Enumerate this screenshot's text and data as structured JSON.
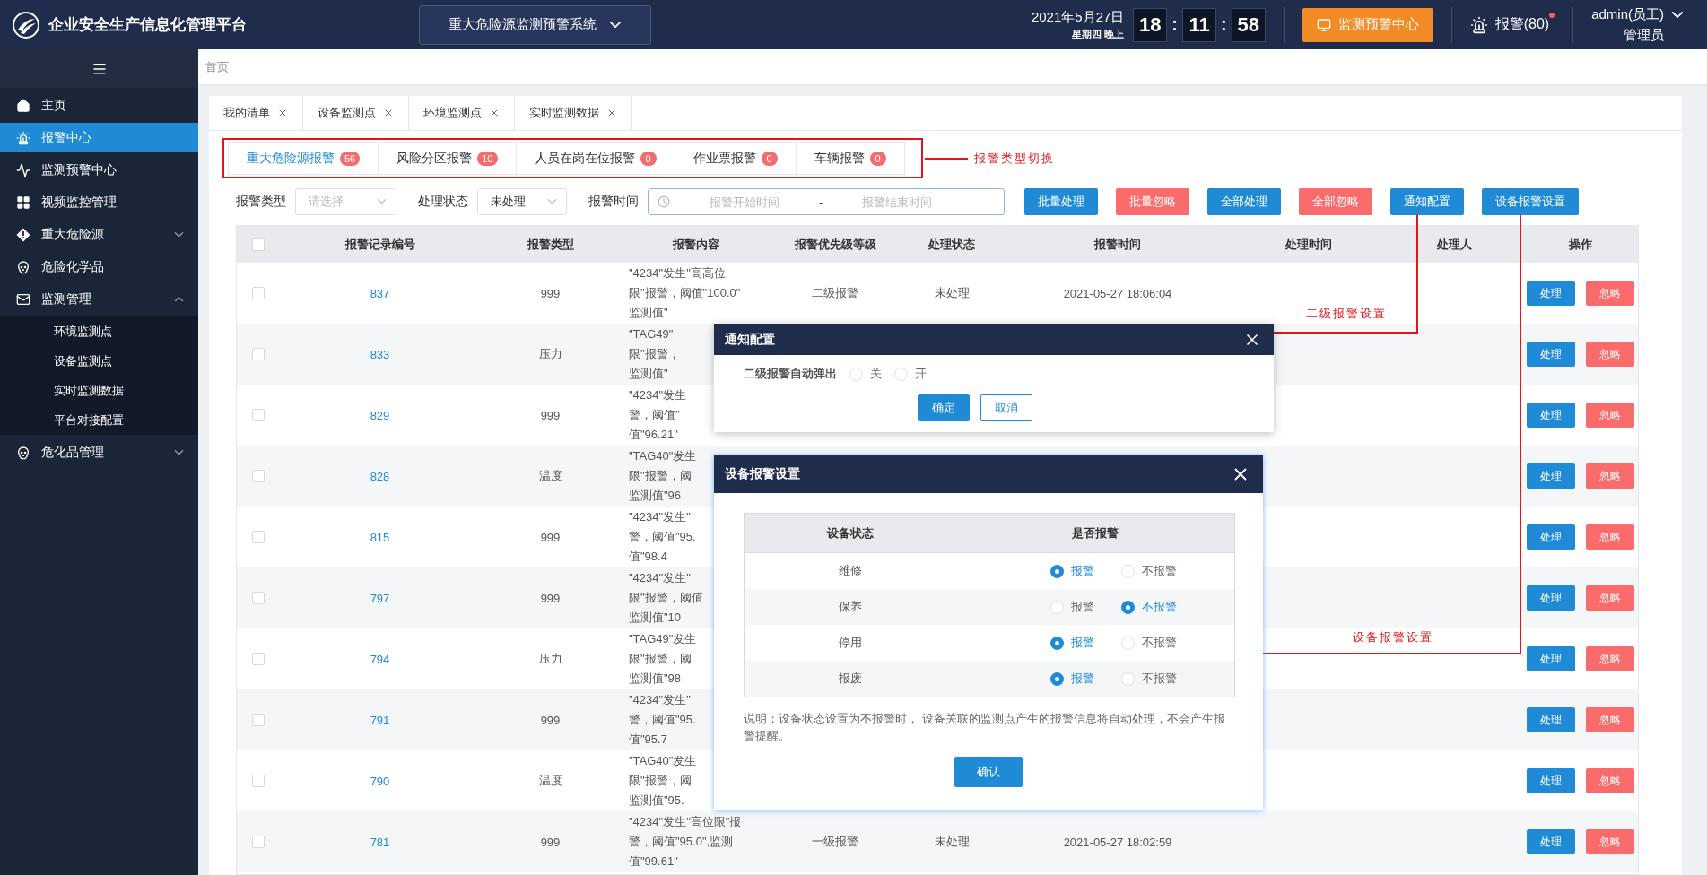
{
  "header": {
    "title": "企业安全生产信息化管理平台",
    "system_select": "重大危险源监测预警系统",
    "date": "2021年5月27日",
    "weekday": "星期四",
    "period": "晚上",
    "clock": [
      {
        "kind": "digit",
        "text": "18"
      },
      {
        "kind": "colon",
        "text": ":"
      },
      {
        "kind": "digit",
        "text": "11"
      },
      {
        "kind": "colon",
        "text": ":"
      },
      {
        "kind": "digit",
        "text": "58"
      }
    ],
    "monitor_button": "监测预警中心",
    "alarm": {
      "label": "报警(80)",
      "unread": true
    },
    "user": {
      "name": "admin(员工)",
      "role": "管理员"
    }
  },
  "sidebar": {
    "items": [
      {
        "label": "主页",
        "selected": false
      },
      {
        "label": "报警中心",
        "selected": true
      },
      {
        "label": "监测预警中心",
        "selected": false
      },
      {
        "label": "视频监控管理",
        "selected": false
      },
      {
        "label": "重大危险源",
        "selected": false,
        "expanded": false
      },
      {
        "label": "危险化学品",
        "selected": false
      },
      {
        "label": "监测管理",
        "selected": false,
        "expanded": true,
        "children": [
          {
            "label": "环境监测点",
            "selected": false
          },
          {
            "label": "设备监测点",
            "selected": false
          },
          {
            "label": "实时监测数据",
            "selected": false
          },
          {
            "label": "平台对接配置",
            "selected": false
          }
        ]
      },
      {
        "label": "危化品管理",
        "selected": false,
        "expanded": false
      }
    ]
  },
  "breadcrumb": [
    "首页"
  ],
  "page_tabs": [
    {
      "label": "我的清单"
    },
    {
      "label": "设备监测点"
    },
    {
      "label": "环境监测点"
    },
    {
      "label": "实时监测数据"
    }
  ],
  "alarm_tabs": [
    {
      "label": "重大危险源报警",
      "count": "56",
      "selected": true
    },
    {
      "label": "风险分区报警",
      "count": "10",
      "selected": false
    },
    {
      "label": "人员在岗在位报警",
      "count": "0",
      "selected": false
    },
    {
      "label": "作业票报警",
      "count": "0",
      "selected": false
    },
    {
      "label": "车辆报警",
      "count": "0",
      "selected": false
    }
  ],
  "annotations": {
    "tabs": "报警类型切换",
    "notify": "二级报警设置",
    "device": "设备报警设置"
  },
  "filters": {
    "type": {
      "label": "报警类型",
      "placeholder": "请选择"
    },
    "status": {
      "label": "处理状态",
      "value": "未处理"
    },
    "time": {
      "label": "报警时间",
      "start_placeholder": "报警开始时间",
      "separator": "-",
      "end_placeholder": "报警结束时间"
    }
  },
  "actions": [
    {
      "label": "批量处理",
      "kind": "primary"
    },
    {
      "label": "批量忽略",
      "kind": "danger"
    },
    {
      "label": "全部处理",
      "kind": "primary"
    },
    {
      "label": "全部忽略",
      "kind": "danger"
    },
    {
      "label": "通知配置",
      "kind": "primary"
    },
    {
      "label": "设备报警设置",
      "kind": "primary"
    }
  ],
  "table": {
    "all_checked": false,
    "columns": [
      "报警记录编号",
      "报警类型",
      "报警内容",
      "报警优先级等级",
      "处理状态",
      "报警时间",
      "处理时间",
      "处理人",
      "操作"
    ],
    "rows": [
      {
        "checked": false,
        "id": "837",
        "type": "999",
        "content": [
          "\"4234\"发生\"高高位",
          "限\"报警，阈值\"100.0\"",
          "监测值\""
        ],
        "priority": "二级报警",
        "status": "未处理",
        "time": "2021-05-27 18:06:04",
        "actions": [
          "处理",
          "忽略"
        ]
      },
      {
        "checked": false,
        "id": "833",
        "type": "压力",
        "content": [
          "\"TAG49\"",
          "限\"报警，",
          "监测值\""
        ],
        "actions": [
          "处理",
          "忽略"
        ]
      },
      {
        "checked": false,
        "id": "829",
        "type": "999",
        "content": [
          "\"4234\"发生",
          "警，阈值\"",
          "值\"96.21\""
        ],
        "actions": [
          "处理",
          "忽略"
        ]
      },
      {
        "checked": false,
        "id": "828",
        "type": "温度",
        "content": [
          "\"TAG40\"发生",
          "限\"报警，阈",
          "监测值\"96"
        ],
        "actions": [
          "处理",
          "忽略"
        ]
      },
      {
        "checked": false,
        "id": "815",
        "type": "999",
        "content": [
          "\"4234\"发生\"",
          "警，阈值\"95.",
          "值\"98.4"
        ],
        "actions": [
          "处理",
          "忽略"
        ]
      },
      {
        "checked": false,
        "id": "797",
        "type": "999",
        "content": [
          "\"4234\"发生\"",
          "限\"报警，阈值",
          "监测值\"10"
        ],
        "actions": [
          "处理",
          "忽略"
        ]
      },
      {
        "checked": false,
        "id": "794",
        "type": "压力",
        "content": [
          "\"TAG49\"发生",
          "限\"报警，阈",
          "监测值\"98"
        ],
        "actions": [
          "处理",
          "忽略"
        ]
      },
      {
        "checked": false,
        "id": "791",
        "type": "999",
        "content": [
          "\"4234\"发生\"",
          "警，阈值\"95.",
          "值\"95.7"
        ],
        "actions": [
          "处理",
          "忽略"
        ]
      },
      {
        "checked": false,
        "id": "790",
        "type": "温度",
        "content": [
          "\"TAG40\"发生",
          "限\"报警，阈",
          "监测值\"95."
        ],
        "actions": [
          "处理",
          "忽略"
        ]
      },
      {
        "checked": false,
        "id": "781",
        "type": "999",
        "content": [
          "\"4234\"发生\"高位限\"报",
          "警，阈值\"95.0\",监测",
          "值\"99.61\""
        ],
        "priority": "一级报警",
        "status": "未处理",
        "time": "2021-05-27 18:02:59",
        "actions": [
          "处理",
          "忽略"
        ]
      }
    ]
  },
  "notify_dialog": {
    "title": "通知配置",
    "field_label": "二级报警自动弹出",
    "options": [
      {
        "label": "关",
        "selected": false
      },
      {
        "label": "开",
        "selected": false
      }
    ],
    "confirm": "确定",
    "cancel": "取消"
  },
  "device_dialog": {
    "title": "设备报警设置",
    "columns": [
      "设备状态",
      "是否报警"
    ],
    "rows": [
      {
        "status": "维修",
        "options": [
          {
            "label": "报警",
            "selected": true
          },
          {
            "label": "不报警",
            "selected": false
          }
        ]
      },
      {
        "status": "保养",
        "options": [
          {
            "label": "报警",
            "selected": false
          },
          {
            "label": "不报警",
            "selected": true
          }
        ]
      },
      {
        "status": "停用",
        "options": [
          {
            "label": "报警",
            "selected": true
          },
          {
            "label": "不报警",
            "selected": false
          }
        ]
      },
      {
        "status": "报废",
        "options": [
          {
            "label": "报警",
            "selected": true
          },
          {
            "label": "不报警",
            "selected": false
          }
        ]
      }
    ],
    "note": "说明：设备状态设置为不报警时， 设备关联的监测点产生的报警信息将自动处理，不会产生报警提醒。",
    "confirm": "确认"
  }
}
